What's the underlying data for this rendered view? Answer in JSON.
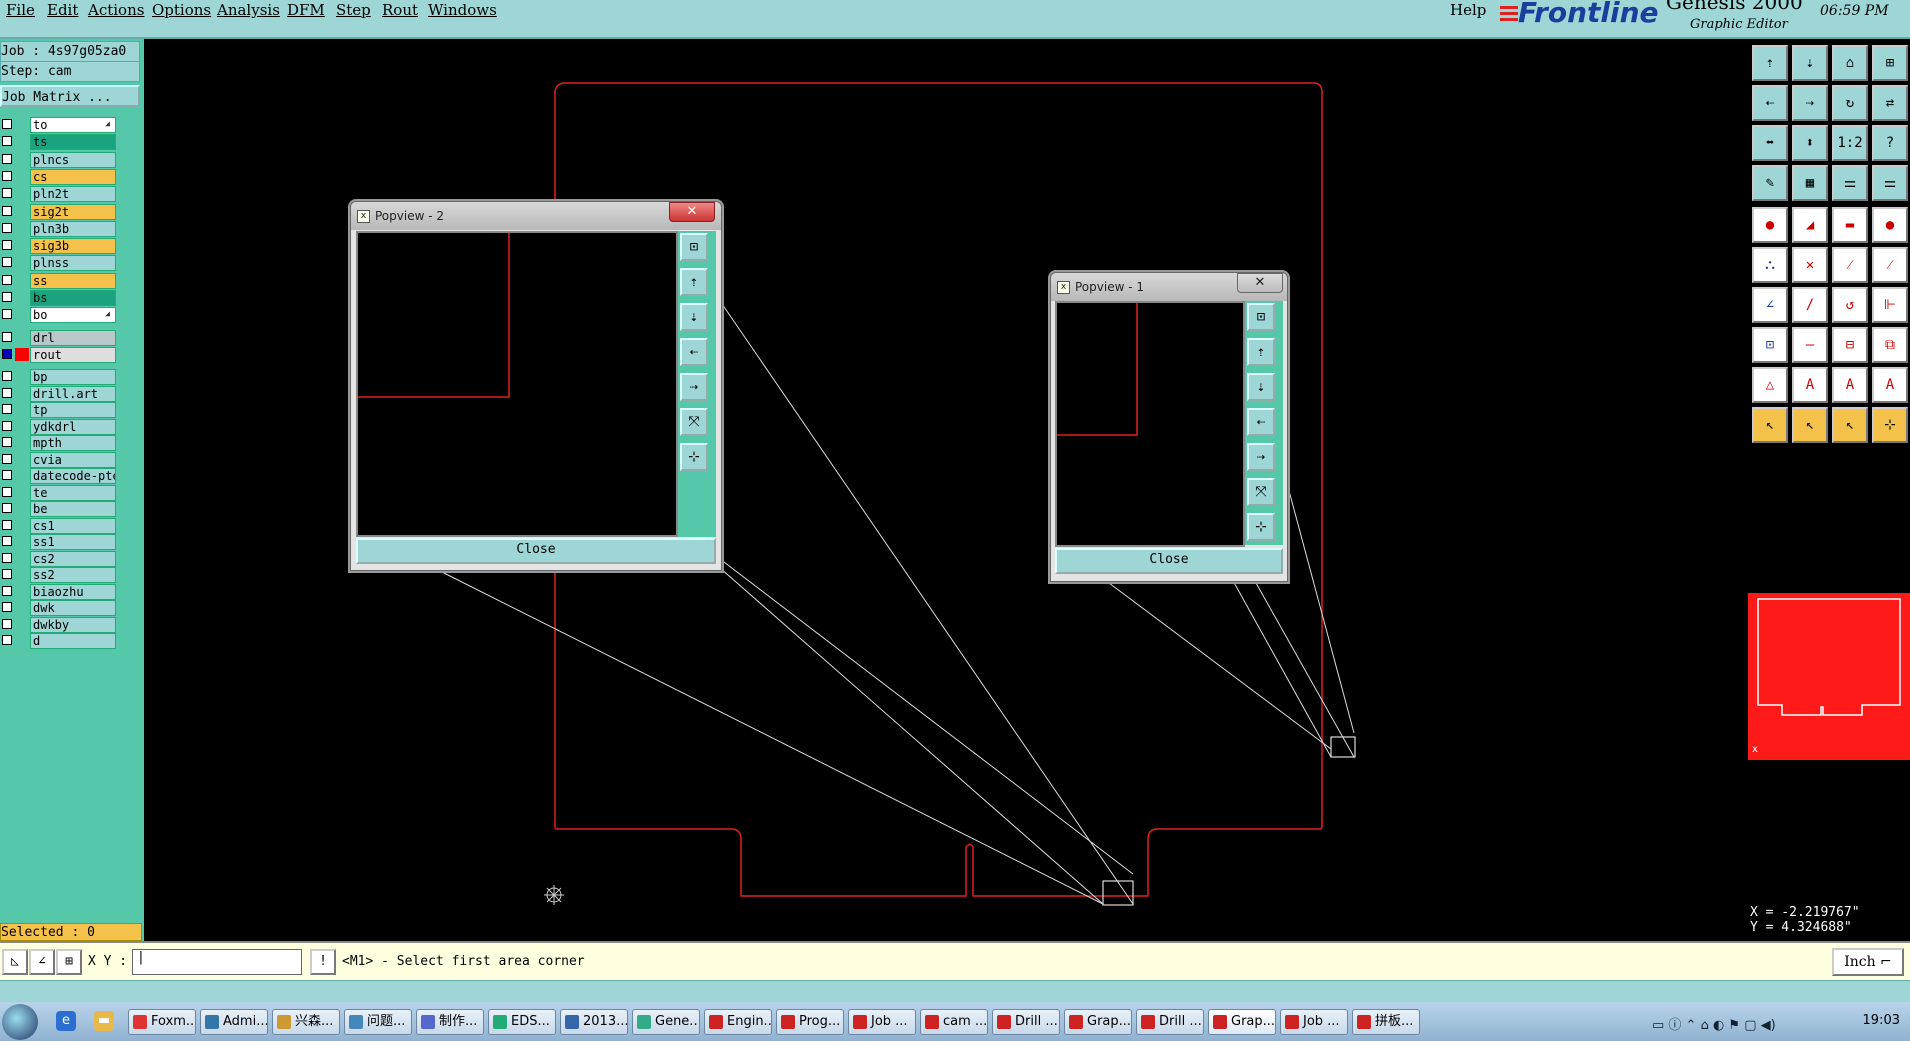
{
  "menubar": {
    "items": [
      "File",
      "Edit",
      "Actions",
      "Options",
      "Analysis",
      "DFM",
      "Step",
      "Rout",
      "Windows"
    ],
    "help": "Help"
  },
  "brand": {
    "logo": "Frontline",
    "product": "Genesis 2000",
    "subtitle": "Graphic Editor",
    "time": "06:59 PM"
  },
  "left": {
    "job": "Job : 4s97g05za0",
    "step": "Step: cam",
    "job_matrix": "Job Matrix ...",
    "selected": "Selected : 0",
    "layers": [
      {
        "name": "to",
        "color": "#ffffff",
        "arrow": true
      },
      {
        "name": "ts",
        "color": "#1aa37f"
      },
      {
        "name": "plncs",
        "color": "#9ed6d6"
      },
      {
        "name": "cs",
        "color": "#f4c24a"
      },
      {
        "name": "pln2t",
        "color": "#9ed6d6"
      },
      {
        "name": "sig2t",
        "color": "#f4c24a"
      },
      {
        "name": "pln3b",
        "color": "#9ed6d6"
      },
      {
        "name": "sig3b",
        "color": "#f4c24a"
      },
      {
        "name": "plnss",
        "color": "#9ed6d6"
      },
      {
        "name": "ss",
        "color": "#f4c24a"
      },
      {
        "name": "bs",
        "color": "#1aa37f"
      },
      {
        "name": "bo",
        "color": "#ffffff",
        "arrow": true
      },
      {
        "name": "drl",
        "color": "#b8c8c8"
      },
      {
        "name": "rout",
        "color": "#dedede",
        "active": true
      },
      {
        "name": "bp",
        "color": "#9ed6d6"
      },
      {
        "name": "drill.art",
        "color": "#9ed6d6"
      },
      {
        "name": "tp",
        "color": "#9ed6d6"
      },
      {
        "name": "ydkdrl",
        "color": "#9ed6d6"
      },
      {
        "name": "mpth",
        "color": "#9ed6d6"
      },
      {
        "name": "cvia",
        "color": "#9ed6d6"
      },
      {
        "name": "datecode-pte",
        "color": "#9ed6d6"
      },
      {
        "name": "te",
        "color": "#9ed6d6"
      },
      {
        "name": "be",
        "color": "#9ed6d6"
      },
      {
        "name": "cs1",
        "color": "#9ed6d6"
      },
      {
        "name": "ss1",
        "color": "#9ed6d6"
      },
      {
        "name": "cs2",
        "color": "#9ed6d6"
      },
      {
        "name": "ss2",
        "color": "#9ed6d6"
      },
      {
        "name": "biaozhu",
        "color": "#9ed6d6"
      },
      {
        "name": "dwk",
        "color": "#9ed6d6"
      },
      {
        "name": "dwkby",
        "color": "#9ed6d6"
      },
      {
        "name": "d",
        "color": "#9ed6d6"
      }
    ]
  },
  "popview2": {
    "title": "Popview - 2",
    "close": "Close"
  },
  "popview1": {
    "title": "Popview - 1",
    "close": "Close"
  },
  "coords": {
    "x": "X = -2.219767\"",
    "y": "Y = 4.324688\""
  },
  "status": {
    "xy_label": "X Y :",
    "prompt": "<M1> - Select first area corner",
    "unit": "Inch"
  },
  "toolbar": {
    "buttons": [
      [
        "⇡",
        "⇣",
        "⌂",
        "⊞"
      ],
      [
        "⇠",
        "⇢",
        "↻",
        "⇄"
      ],
      [
        "⬌",
        "⬍",
        "1:2",
        "?"
      ],
      [
        "✎",
        "▦",
        "⚌",
        "⚌"
      ],
      [
        "●",
        "◢",
        "▬",
        "●"
      ],
      [
        "⛬",
        "✕",
        "⁄",
        "⁄"
      ],
      [
        "∠",
        "/",
        "↺",
        "⊩"
      ],
      [
        "⊡",
        "—",
        "⊟",
        "⧉"
      ],
      [
        "△",
        "A",
        "A",
        "A"
      ],
      [
        "↖",
        "↖",
        "↖",
        "⊹"
      ]
    ]
  },
  "taskbar": {
    "tasks": [
      "Foxm...",
      "Admi...",
      "兴森...",
      "问题...",
      "制作...",
      "EDS...",
      "2013...",
      "Gene...",
      "Engin...",
      "Prog...",
      "Job ...",
      "cam ...",
      "Drill ...",
      "Grap...",
      "Drill ...",
      "Grap...",
      "Job ...",
      "拼板..."
    ],
    "clock": "19:03"
  },
  "colors": {
    "teal": "#9ed6d6",
    "panel": "#55c8aa",
    "gold": "#f4c24a",
    "rout": "#e02020",
    "thumb": "#ff1a1a"
  }
}
